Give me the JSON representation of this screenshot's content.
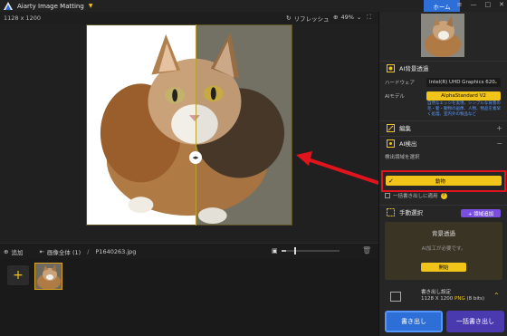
{
  "app": {
    "name": "Aiarty Image Matting",
    "home_tab": "ホーム"
  },
  "toolbar": {
    "dims": "1128 x 1200",
    "refresh": "リフレッシュ",
    "zoom": "49%"
  },
  "bottombar": {
    "add": "追加",
    "all_images": "画像全体 (1)",
    "sep": "/",
    "filename": "P1640263.jpg"
  },
  "right": {
    "ai_bg": "AI背景透過",
    "hardware_label": "ハードウェア",
    "hardware_value": "Intel(R) UHD Graphics 620",
    "model_label": "AIモデル",
    "model_value": "AlphaStandard  V2",
    "model_desc": "自然なエッジを実現、シンプルな背景の毛・髪・動物の画像、人物、物品を素早く処理、室内外の製品など",
    "edit": "編集",
    "ai_detect": "AI検出",
    "detect_region": "検出領域を選択",
    "detect_option": "動物",
    "apply_batch": "一括書き出しに適用",
    "manual_select": "手動選択",
    "add_area": "+ 領域追加",
    "bg_title": "背景透過",
    "bg_sub": "AI加工が必要です。",
    "start": "開始",
    "export_title": "書き出し設定",
    "export_dims": "1128 X 1200",
    "export_fmt": "PNG",
    "export_bits": "(8 bits)",
    "btn_export": "書き出し",
    "btn_batch": "一括書き出し"
  },
  "colors": {
    "accent": "#f0c419",
    "blue": "#2d6fd6",
    "red": "#e0141c",
    "purple": "#4a3ab0"
  }
}
